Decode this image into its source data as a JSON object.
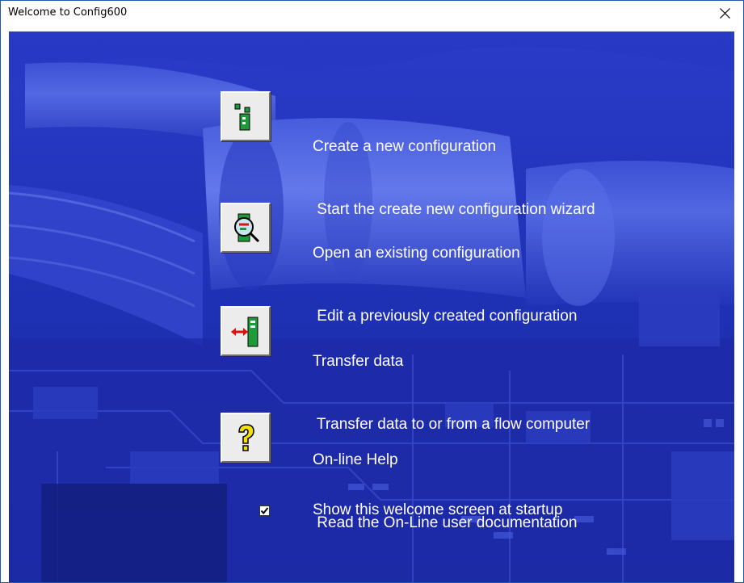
{
  "window": {
    "title": "Welcome to Config600"
  },
  "actions": [
    {
      "title": "Create a new configuration",
      "description": " Start the create new configuration wizard",
      "icon": "new-config-icon"
    },
    {
      "title": "Open an existing configuration",
      "description": " Edit a previously created configuration",
      "icon": "open-config-icon"
    },
    {
      "title": "Transfer data",
      "description": " Transfer data to or from a flow computer",
      "icon": "transfer-data-icon"
    },
    {
      "title": "On-line Help",
      "description": " Read the On-Line user documentation",
      "icon": "help-icon"
    }
  ],
  "startup": {
    "label": "Show this welcome screen at startup",
    "checked": true
  },
  "colors": {
    "background": "#1f2fb8",
    "text": "#ffffff",
    "accent_red": "#e01010",
    "accent_green": "#1f9a3a",
    "accent_yellow": "#f2e000"
  }
}
